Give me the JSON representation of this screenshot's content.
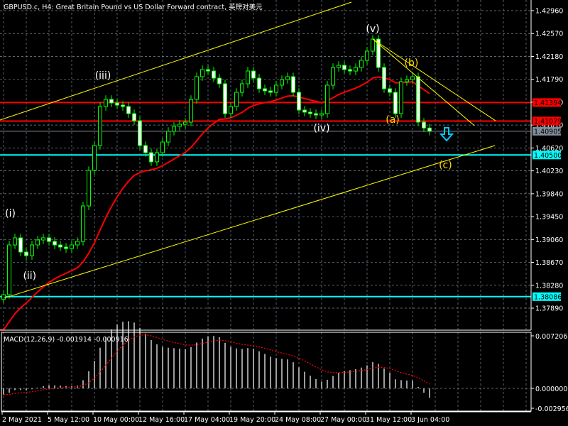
{
  "header": {
    "title": "GBPUSD.c, H4:  Great Britain Pound vs US Dollar Forward contract, 英镑对美元"
  },
  "colors": {
    "background": "#000000",
    "grid": "#7a8a9a",
    "candle": "#00ff00",
    "ma": "#ff0000",
    "level_red": "#ff0000",
    "level_cyan": "#00ffff",
    "bid": "#7f8c99",
    "channel": "#ffff00",
    "wave_white": "#ffffff",
    "wave_yellow": "#ffd700",
    "arrow": "#00ccff"
  },
  "chart_data": [
    {
      "type": "candlestick",
      "title": "GBPUSD.c, H4",
      "ylim": [
        1.3765,
        1.4315
      ],
      "y_ticks": [
        "1.42960",
        "1.42570",
        "1.42180",
        "1.41790",
        "1.41400",
        "1.41010",
        "1.40620",
        "1.40230",
        "1.39840",
        "1.39450",
        "1.39060",
        "1.38670",
        "1.38280",
        "1.37890"
      ],
      "x_ticks": [
        {
          "index": -0.25,
          "label": "2 May 2021"
        },
        {
          "index": 7.75,
          "label": "5 May 12:00"
        },
        {
          "index": 15.75,
          "label": "10 May 00:00"
        },
        {
          "index": 23.75,
          "label": "12 May 16:00"
        },
        {
          "index": 31.75,
          "label": "17 May 04:00"
        },
        {
          "index": 39.75,
          "label": "19 May 20:00"
        },
        {
          "index": 47.75,
          "label": "24 May 08:00"
        },
        {
          "index": 55.75,
          "label": "27 May 00:00"
        },
        {
          "index": 63.75,
          "label": "31 May 12:00"
        },
        {
          "index": 71.75,
          "label": "3 Jun 04:00"
        }
      ],
      "closes": [
        1.3812,
        1.38967,
        1.39088,
        1.38846,
        1.38785,
        1.38967,
        1.39052,
        1.39088,
        1.39027,
        1.38967,
        1.38931,
        1.38906,
        1.38967,
        1.39027,
        1.39632,
        1.40237,
        1.40661,
        1.41326,
        1.41447,
        1.41387,
        1.41351,
        1.41326,
        1.41205,
        1.41084,
        1.40661,
        1.4054,
        1.40383,
        1.4054,
        1.40721,
        1.40903,
        1.40988,
        1.41024,
        1.4106,
        1.41447,
        1.41835,
        1.41956,
        1.41931,
        1.4181,
        1.41714,
        1.41205,
        1.41326,
        1.41568,
        1.41714,
        1.41931,
        1.4181,
        1.41629,
        1.41593,
        1.41568,
        1.4169,
        1.41786,
        1.41835,
        1.41568,
        1.41266,
        1.4123,
        1.41205,
        1.41181,
        1.41205,
        1.4169,
        1.41992,
        1.42028,
        1.41956,
        1.41931,
        1.41992,
        1.42113,
        1.4227,
        1.42476,
        1.41992,
        1.41629,
        1.41568,
        1.41205,
        1.4175,
        1.41786,
        1.41835,
        1.4106,
        1.4096,
        1.40905
      ],
      "ma_period": 20,
      "levels": [
        {
          "price": 1.41394,
          "label": "1.41394",
          "kind": "red"
        },
        {
          "price": 1.41079,
          "label": "1.41079",
          "kind": "red"
        },
        {
          "price": 1.40905,
          "label": "1.40905",
          "kind": "bid"
        },
        {
          "price": 1.405,
          "label": "1.40500",
          "kind": "cyan"
        },
        {
          "price": 1.38086,
          "label": "1.38086",
          "kind": "cyan"
        }
      ],
      "trendlines": [
        {
          "name": "channel-upper",
          "from": [
            -0.625,
            1.41097
          ],
          "to": [
            61.25,
            1.43105
          ]
        },
        {
          "name": "channel-lower",
          "from": [
            0,
            1.38059
          ],
          "to": [
            86.5,
            1.40661
          ]
        },
        {
          "name": "triangle-line-1",
          "from": [
            65,
            1.42476
          ],
          "to": [
            86.6,
            1.41085
          ]
        },
        {
          "name": "triangle-line-2",
          "from": [
            65,
            1.42476
          ],
          "to": [
            82.9,
            1.41
          ]
        }
      ],
      "wave_labels": [
        {
          "text": "(i)",
          "index": 1.2,
          "price": 1.39512,
          "color": "white"
        },
        {
          "text": "(ii)",
          "index": 4.6,
          "price": 1.38447,
          "color": "white"
        },
        {
          "text": "(iii)",
          "index": 17.5,
          "price": 1.41859,
          "color": "white"
        },
        {
          "text": "(iv)",
          "index": 56,
          "price": 1.40963,
          "color": "white"
        },
        {
          "text": "(v)",
          "index": 65,
          "price": 1.42657,
          "color": "white"
        },
        {
          "text": "(a)",
          "index": 68.5,
          "price": 1.41109,
          "color": "yellow"
        },
        {
          "text": "(b)",
          "index": 71.8,
          "price": 1.42077,
          "color": "yellow"
        },
        {
          "text": "(c)",
          "index": 77.8,
          "price": 1.40334,
          "color": "yellow"
        }
      ],
      "arrow": {
        "direction": "down",
        "index": 78,
        "price": 1.40842
      }
    },
    {
      "type": "bar+line",
      "title": "MACD(12,26,9) -0.001914 -0.000916",
      "indicator": "MACD(12,26,9)",
      "main_value": "-0.001914",
      "signal_value": "-0.000916",
      "ylim": [
        -0.002956,
        0.007206
      ],
      "y_ticks": [
        "0.007206",
        "0.000000",
        "-0.002956"
      ]
    }
  ]
}
